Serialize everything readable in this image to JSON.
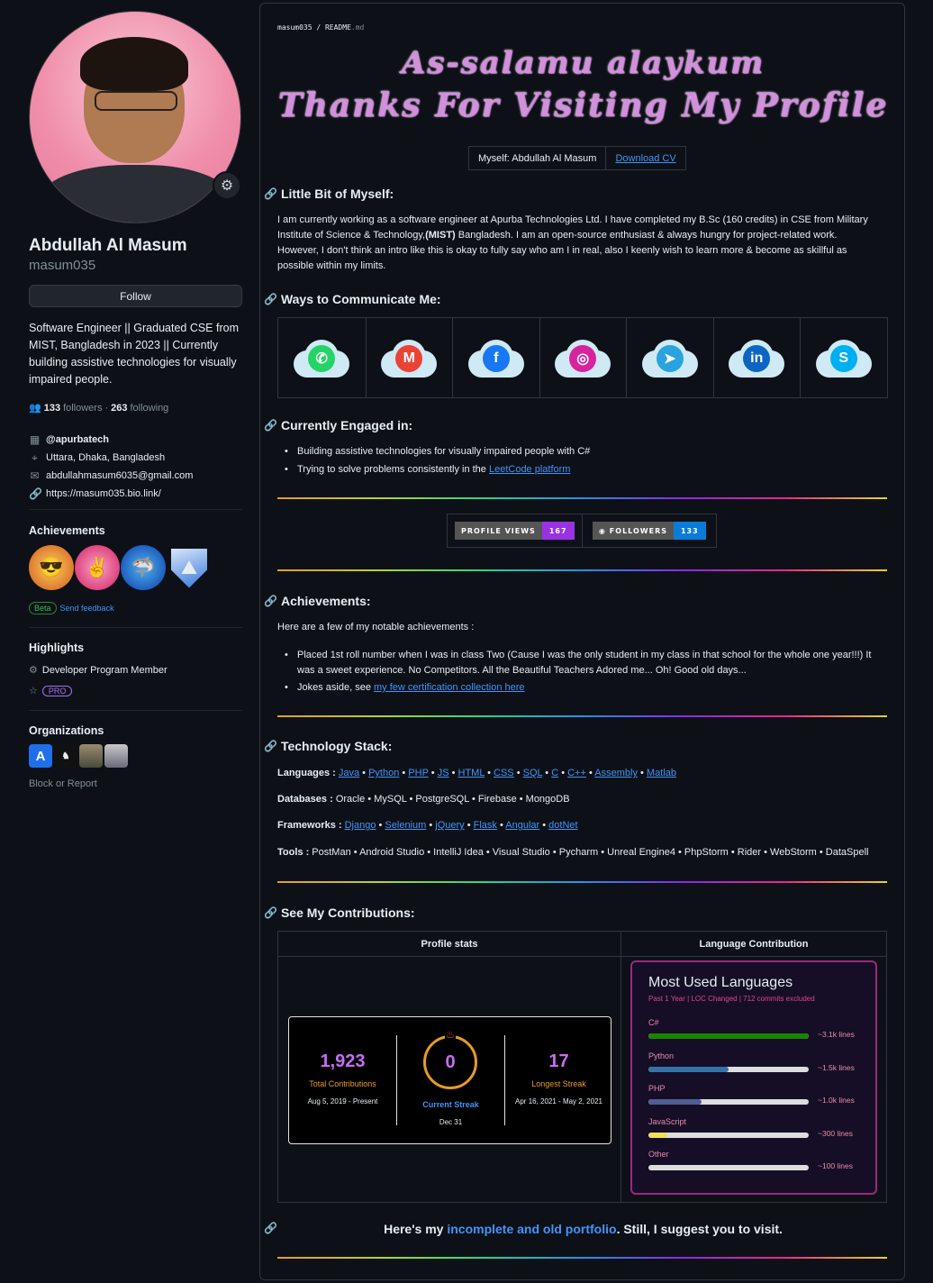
{
  "profile": {
    "name": "Abdullah Al Masum",
    "login": "masum035",
    "follow_label": "Follow",
    "bio": "Software Engineer || Graduated CSE from MIST, Bangladesh in 2023 || Currently building assistive technologies for visually impaired people.",
    "followers_count": "133",
    "followers_label": "followers",
    "dot": "·",
    "following_count": "263",
    "following_label": "following",
    "company": "@apurbatech",
    "location": "Uttara, Dhaka, Bangladesh",
    "email": "abdullahmasum6035@gmail.com",
    "website": "https://masum035.bio.link/"
  },
  "achievements": {
    "title": "Achievements",
    "beta": "Beta",
    "feedback": "Send feedback"
  },
  "highlights": {
    "title": "Highlights",
    "dev_program": "Developer Program Member",
    "pro": "PRO"
  },
  "organizations": {
    "title": "Organizations",
    "block": "Block or Report"
  },
  "readme": {
    "crumb_user": "masum035",
    "crumb_sep": " / ",
    "crumb_file": "README",
    "crumb_ext": ".md",
    "hero_line1": "As-salamu alaykum",
    "hero_line2": "Thanks For Visiting My Profile",
    "myself": "Myself: Abdullah Al Masum",
    "download_cv": "Download CV",
    "about_title": "Little Bit of Myself:",
    "about_text_1": "I am currently working as a software engineer at Apurba Technologies Ltd. I have completed my B.Sc (160 credits) in CSE from Military Institute of Science & Technology,",
    "about_text_bold": "(MIST)",
    "about_text_2": " Bangladesh. I am an open-source enthusiast & always hungry for project-related work. However, I don't think an intro like this is okay to fully say who am I in real, also I keenly wish to learn more & become as skillful as possible within my limits.",
    "communicate_title": "Ways to Communicate Me:",
    "engaged_title": "Currently Engaged in:",
    "engaged_1": "Building assistive technologies for visually impaired people with C#",
    "engaged_2_pre": "Trying to solve problems consistently in the ",
    "engaged_2_link": "LeetCode platform",
    "badge_views_label": "PROFILE VIEWS",
    "badge_views_value": "167",
    "badge_followers_label": "FOLLOWERS",
    "badge_followers_value": "133",
    "ach_title": "Achievements:",
    "ach_intro": "Here are a few of my notable achievements :",
    "ach_1": "Placed 1st roll number when I was in class Two (Cause I was the only student in my class in that school for the whole one year!!!) It was a sweet experience. No Competitors. All the Beautiful Teachers Adored me... Oh! Good old days...",
    "ach_2_pre": "Jokes aside, see ",
    "ach_2_link": "my few certification collection here",
    "tech_title": "Technology Stack:",
    "lang_label": "Languages :",
    "db_label": "Databases :",
    "db_text": "Oracle • MySQL • PostgreSQL • Firebase • MongoDB",
    "fw_label": "Frameworks :",
    "tools_label": "Tools :",
    "tools_text": "PostMan • Android Studio • IntelliJ Idea • Visual Studio • Pycharm • Unreal Engine4 • PhpStorm • Rider • WebStorm • DataSpell",
    "contrib_title": "See My Contributions:",
    "col_stats": "Profile stats",
    "col_lang": "Language Contribution",
    "portfolio_pre": "Here's my ",
    "portfolio_link": "incomplete and old portfolio",
    "portfolio_post": ". Still, I suggest you to visit."
  },
  "languages": [
    "Java",
    "Python",
    "PHP",
    "JS",
    "HTML",
    "CSS",
    "SQL",
    "C",
    "C++",
    "Assembly",
    "Matlab"
  ],
  "frameworks": [
    "Django",
    "Selenium",
    "jQuery",
    "Flask",
    "Angular",
    "dotNet"
  ],
  "streak": {
    "total": "1,923",
    "total_label": "Total Contributions",
    "total_range": "Aug 5, 2019 - Present",
    "current": "0",
    "current_label": "Current Streak",
    "current_date": "Dec 31",
    "longest": "17",
    "longest_label": "Longest Streak",
    "longest_range": "Apr 16, 2021 - May 2, 2021"
  },
  "lang_card": {
    "title": "Most Used Languages",
    "subtitle": "Past 1 Year | LOC Changed | 712 commits excluded",
    "items": [
      {
        "name": "C#",
        "value": "~3.1k lines",
        "fraction": 1.0,
        "color": "#178600"
      },
      {
        "name": "Python",
        "value": "~1.5k lines",
        "fraction": 0.5,
        "color": "#3572A5"
      },
      {
        "name": "PHP",
        "value": "~1.0k lines",
        "fraction": 0.33,
        "color": "#4F5D95"
      },
      {
        "name": "JavaScript",
        "value": "~300 lines",
        "fraction": 0.12,
        "color": "#f1e05a"
      },
      {
        "name": "Other",
        "value": "~100 lines",
        "fraction": 0.0,
        "color": "#ededed"
      }
    ]
  },
  "contacts": [
    {
      "icon": "whatsapp-icon",
      "color": "#25d366"
    },
    {
      "icon": "gmail-icon",
      "color": "#ea4335"
    },
    {
      "icon": "facebook-icon",
      "color": "#1877f2"
    },
    {
      "icon": "instagram-icon",
      "color": "#d6249f"
    },
    {
      "icon": "telegram-icon",
      "color": "#2aa3df"
    },
    {
      "icon": "linkedin-icon",
      "color": "#0a66c2"
    },
    {
      "icon": "skype-icon",
      "color": "#00aff0"
    }
  ],
  "colors": {
    "accent": "#4493f8",
    "views_badge": "#9a31e3",
    "followers_badge": "#0a7bd6"
  }
}
